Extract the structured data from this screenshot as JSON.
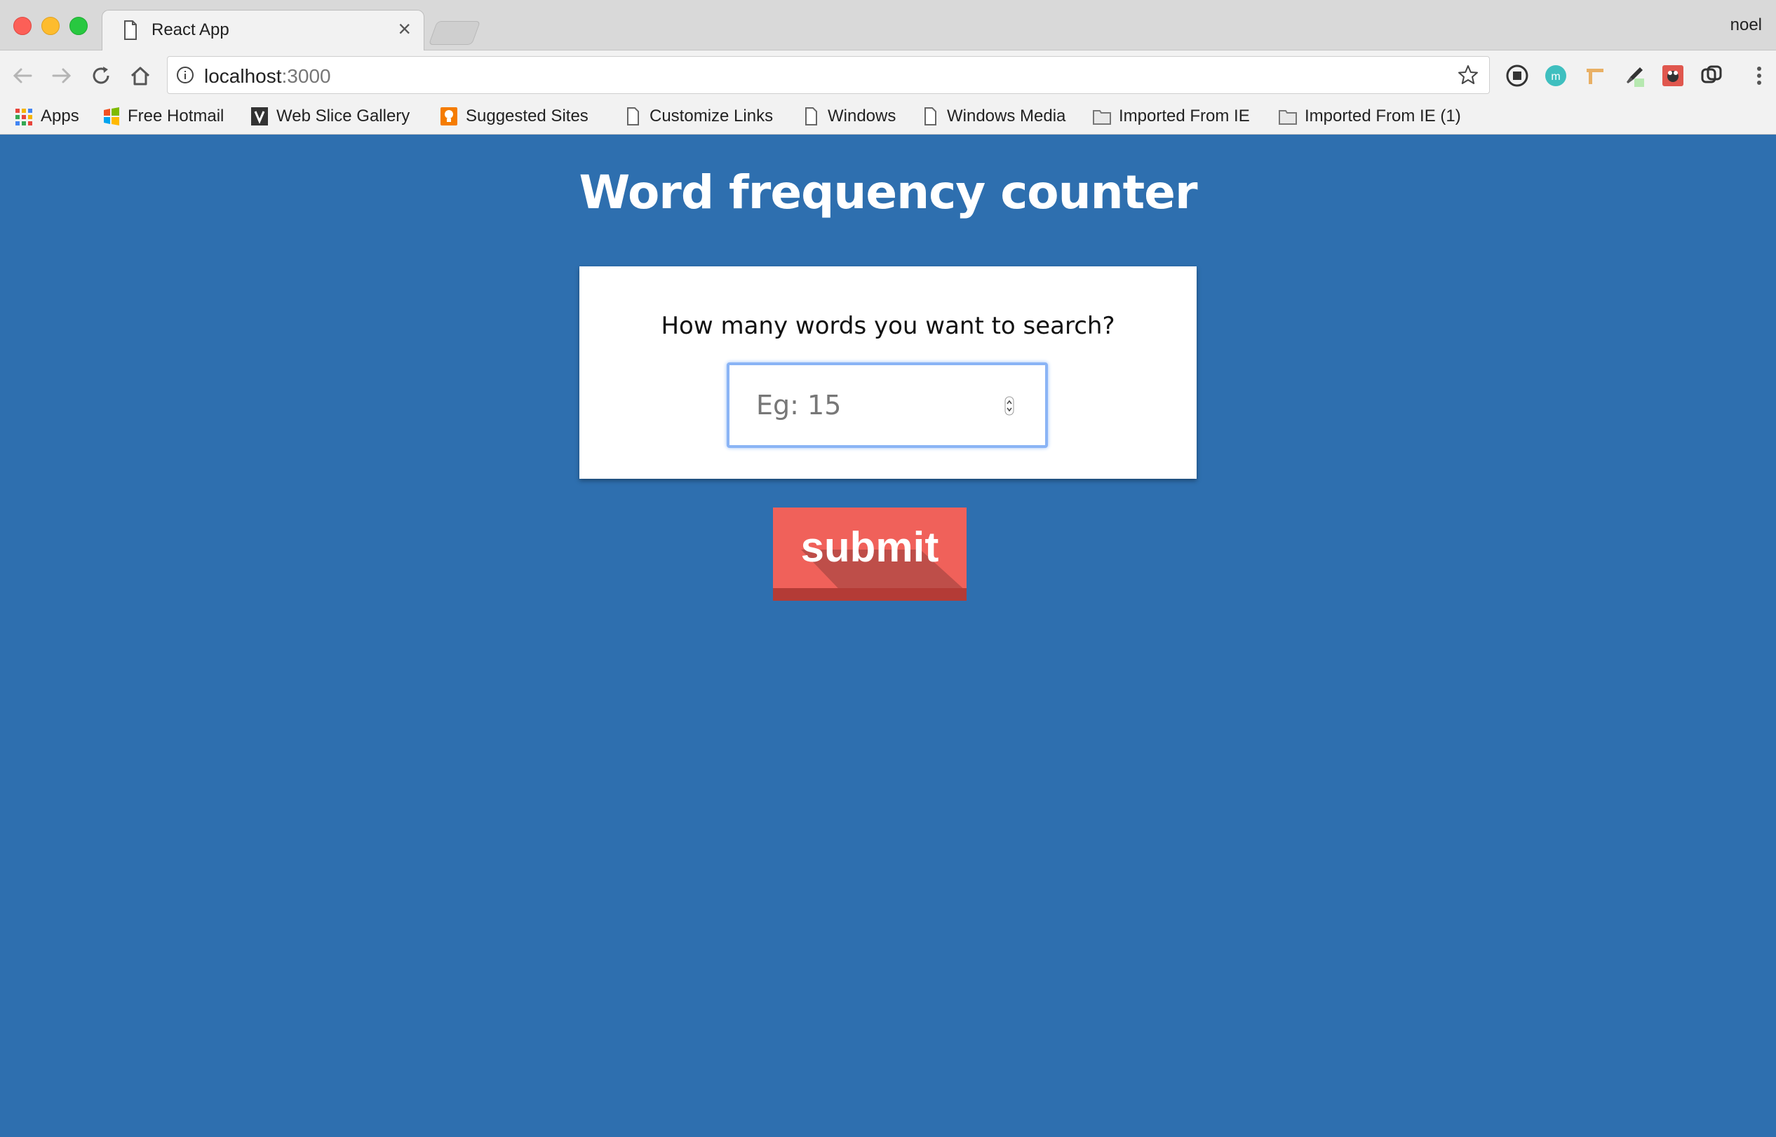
{
  "browser": {
    "tab_title": "React App",
    "profile_name": "noel",
    "url_host": "localhost",
    "url_port": ":3000",
    "bookmarks": [
      {
        "label": "Apps",
        "icon": "apps-grid-icon"
      },
      {
        "label": "Free Hotmail",
        "icon": "windows-logo-icon"
      },
      {
        "label": "Web Slice Gallery",
        "icon": "web-slice-icon"
      },
      {
        "label": "Suggested Sites",
        "icon": "suggested-sites-icon"
      },
      {
        "label": "Customize Links",
        "icon": "page-icon"
      },
      {
        "label": "Windows",
        "icon": "page-icon"
      },
      {
        "label": "Windows Media",
        "icon": "page-icon"
      },
      {
        "label": "Imported From IE",
        "icon": "folder-icon"
      },
      {
        "label": "Imported From IE (1)",
        "icon": "folder-icon"
      }
    ]
  },
  "page": {
    "title": "Word frequency counter",
    "prompt": "How many words you want to search?",
    "input_placeholder": "Eg: 15",
    "input_value": "",
    "submit_label": "submit"
  },
  "colors": {
    "page_background": "#2e6faf",
    "submit_button": "#f0615a",
    "input_focus_ring": "#8ab4f5"
  }
}
